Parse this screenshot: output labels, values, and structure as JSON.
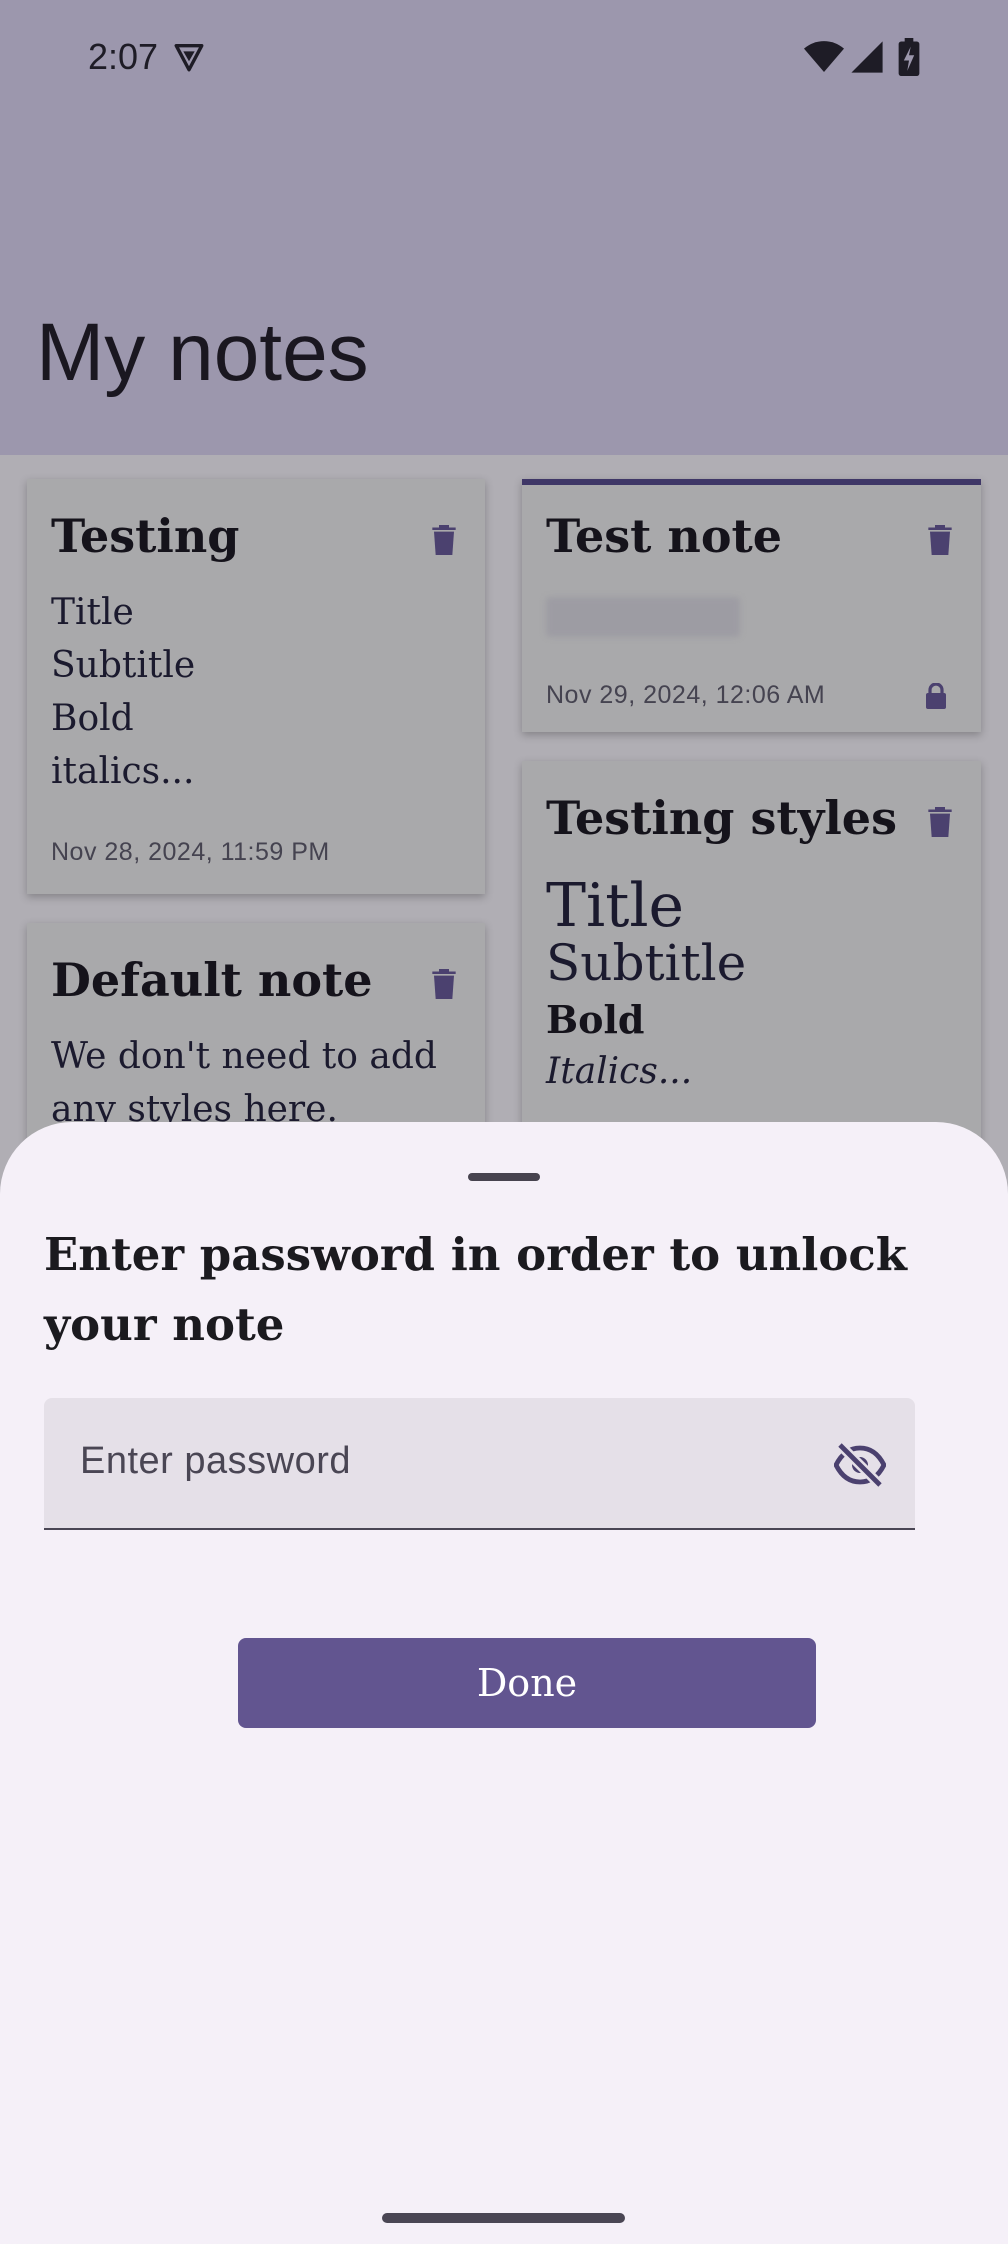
{
  "status_bar": {
    "time": "2:07"
  },
  "app_bar": {
    "title": "My notes"
  },
  "notes": [
    {
      "title": "Testing",
      "body_lines": [
        "Title",
        "Subtitle",
        "Bold",
        "italics..."
      ],
      "date": "Nov 28, 2024, 11:59 PM"
    },
    {
      "title": "Test note",
      "date": "Nov 29, 2024, 12:06 AM",
      "locked": true
    },
    {
      "title": "Default note",
      "body_lines": [
        "We don't need to add",
        "any styles here."
      ]
    },
    {
      "title": "Testing styles",
      "styled_lines": [
        "Title",
        "Subtitle",
        "Bold",
        "Italics..."
      ]
    }
  ],
  "sheet": {
    "title": "Enter password in order to unlock your note",
    "password_placeholder": "Enter password",
    "done_label": "Done"
  },
  "colors": {
    "accent": "#625590",
    "sheet_bg": "#f5f0f8",
    "app_bar": "#9c97ad"
  }
}
